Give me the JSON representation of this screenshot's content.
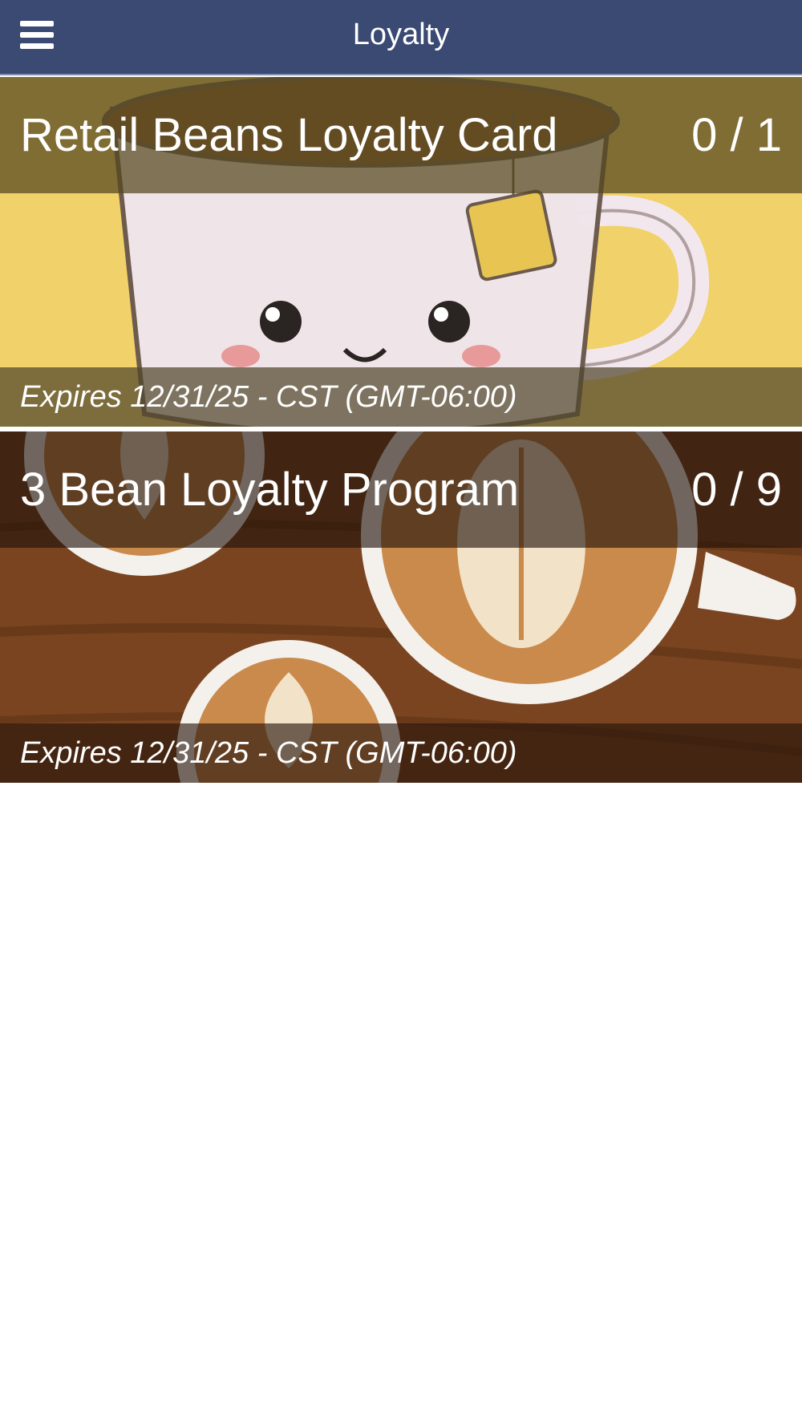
{
  "app_bar": {
    "title": "Loyalty",
    "menu_icon": "hamburger-menu-icon",
    "background": "#3a4a73"
  },
  "cards": [
    {
      "name": "Retail Beans Loyalty Card",
      "count": "0 / 1",
      "expiry": "Expires 12/31/25 - CST (GMT-06:00)",
      "image": "kawaii-tea-cup-illustration"
    },
    {
      "name": "3 Bean Loyalty Program",
      "count": "0 / 9",
      "expiry": "Expires 12/31/25 - CST (GMT-06:00)",
      "image": "latte-art-cups-photo"
    }
  ]
}
